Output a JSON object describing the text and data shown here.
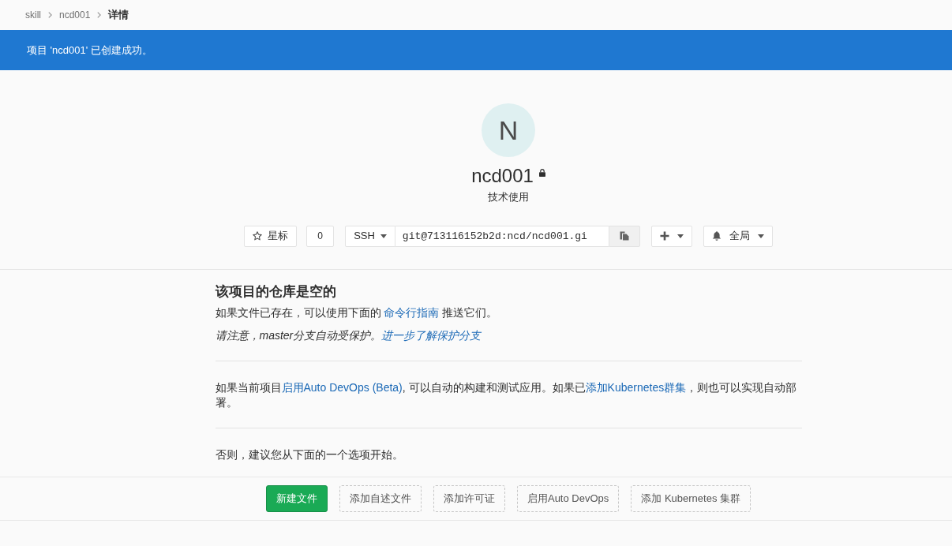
{
  "breadcrumb": [
    {
      "label": "skill",
      "current": false
    },
    {
      "label": "ncd001",
      "current": false
    },
    {
      "label": "详情",
      "current": true
    }
  ],
  "flash": {
    "message": "项目 'ncd001' 已创建成功。"
  },
  "project": {
    "avatar_letter": "N",
    "name": "ncd001",
    "private": true,
    "description": "技术使用"
  },
  "actions": {
    "star": {
      "label": "星标",
      "count": "0"
    },
    "clone": {
      "protocol": "SSH",
      "url": "git@713116152b2d:ncd/ncd001.gi"
    },
    "notifications": {
      "label": "全局"
    }
  },
  "empty_repo": {
    "title": "该项目的仓库是空的",
    "sections": [
      [
        {
          "kind": "text",
          "segments": [
            {
              "kind": "text",
              "text": "如果文件已存在，可以使用下面的 "
            },
            {
              "kind": "link",
              "text": "命令行指南"
            },
            {
              "kind": "text",
              "text": " 推送它们。"
            }
          ]
        },
        {
          "kind": "note",
          "segments": [
            {
              "kind": "text",
              "text": "请注意，master分支自动受保护。"
            },
            {
              "kind": "link",
              "text": "进一步了解保护分支"
            }
          ]
        }
      ],
      [
        {
          "kind": "text",
          "segments": [
            {
              "kind": "text",
              "text": "如果当前项目"
            },
            {
              "kind": "link",
              "text": "启用Auto DevOps (Beta)"
            },
            {
              "kind": "text",
              "text": ", 可以自动的构建和测试应用。如果已"
            },
            {
              "kind": "link",
              "text": "添加Kubernetes群集"
            },
            {
              "kind": "text",
              "text": "，则也可以实现自动部署。"
            }
          ]
        }
      ],
      [
        {
          "kind": "text",
          "segments": [
            {
              "kind": "text",
              "text": "否则，建议您从下面的一个选项开始。"
            }
          ]
        }
      ]
    ]
  },
  "quick_actions": [
    {
      "label": "新建文件",
      "kind": "primary"
    },
    {
      "label": "添加自述文件",
      "kind": "dashed"
    },
    {
      "label": "添加许可证",
      "kind": "dashed"
    },
    {
      "label": "启用Auto DevOps",
      "kind": "dashed"
    },
    {
      "label": "添加 Kubernetes 集群",
      "kind": "dashed"
    }
  ]
}
